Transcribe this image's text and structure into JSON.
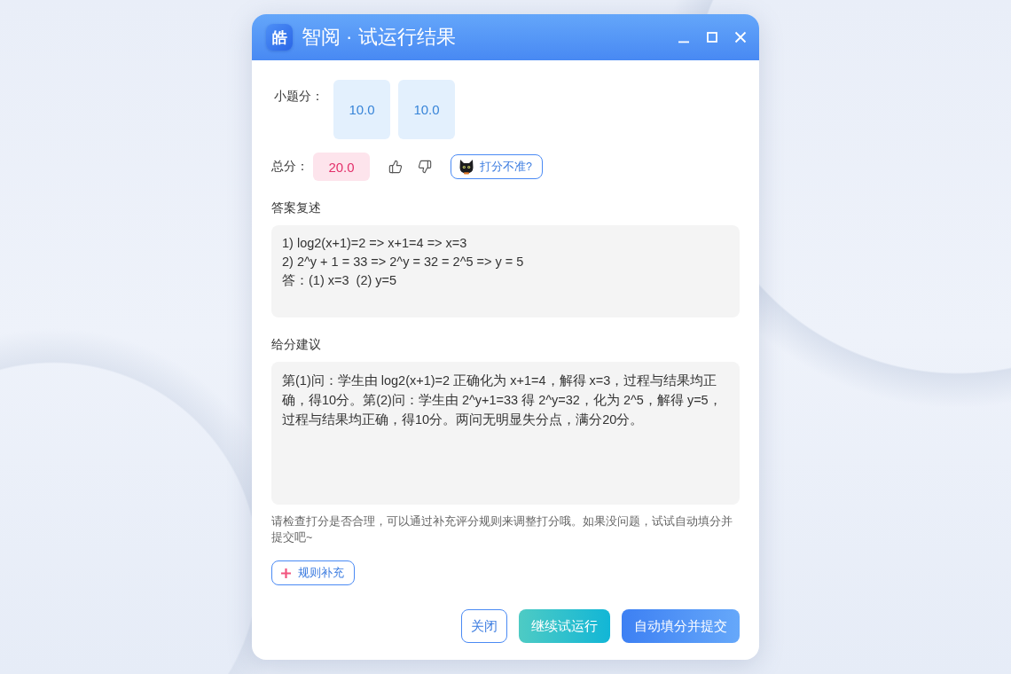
{
  "window": {
    "logo": "皓",
    "title": "智阅 · 试运行结果"
  },
  "sub_scores": {
    "label": "小题分：",
    "scores": [
      "10.0",
      "10.0"
    ]
  },
  "total": {
    "label": "总分：",
    "value": "20.0",
    "feedback_button": "打分不准?"
  },
  "answer_summary": {
    "heading": "答案复述",
    "lines": [
      "1) log2(x+1)=2 => x+1=4 => x=3",
      "2) 2^y + 1 = 33 => 2^y = 32 = 2^5 => y = 5",
      "答：(1) x=3  (2) y=5"
    ]
  },
  "grading_suggestion": {
    "heading": "给分建议",
    "text": "第(1)问：学生由 log2(x+1)=2 正确化为 x+1=4，解得 x=3，过程与结果均正确，得10分。第(2)问：学生由 2^y+1=33 得 2^y=32，化为 2^5，解得 y=5，过程与结果均正确，得10分。两问无明显失分点，满分20分。"
  },
  "note": "请检查打分是否合理，可以通过补充评分规则来调整打分哦。如果没问题，试试自动填分并提交吧~",
  "add_rule_button": "规则补充",
  "buttons": [
    {
      "label": "关闭",
      "kind": "outline"
    },
    {
      "label": "继续试运行",
      "kind": "teal"
    },
    {
      "label": "自动填分并提交",
      "kind": "primary"
    }
  ]
}
